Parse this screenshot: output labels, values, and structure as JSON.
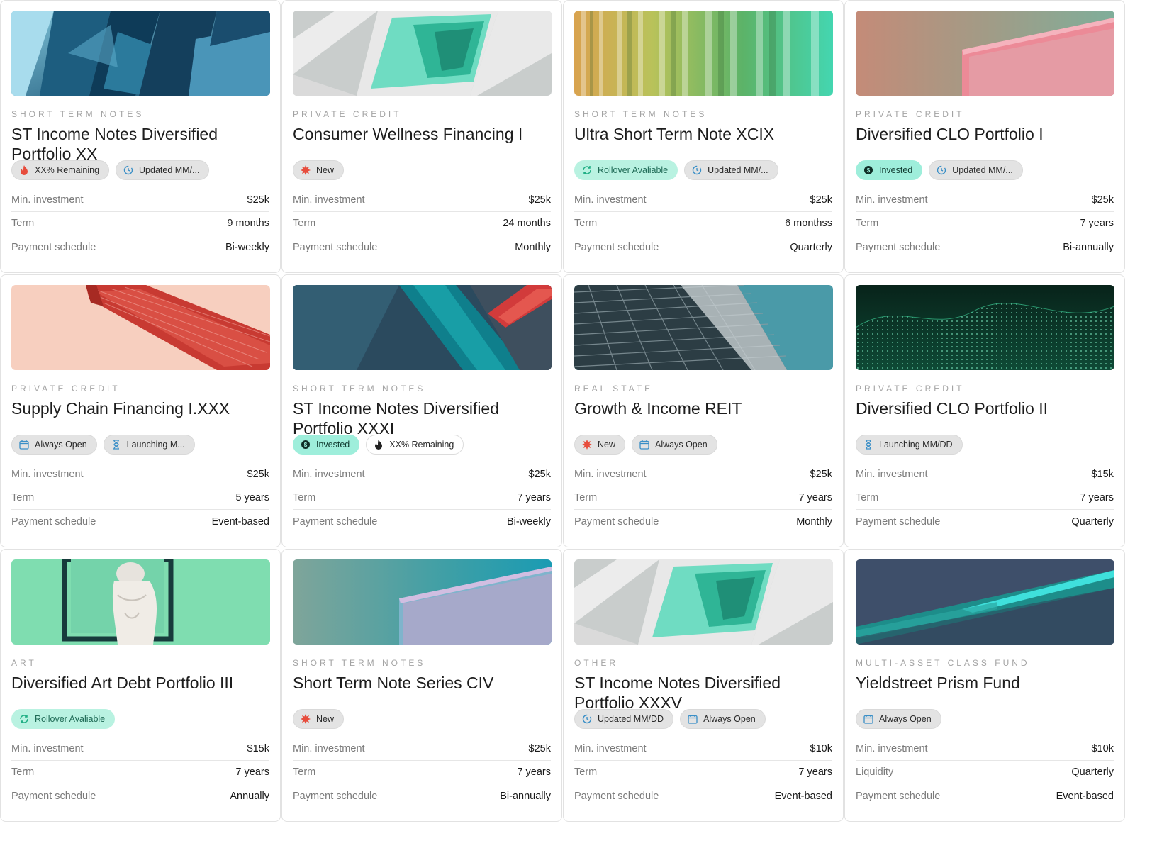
{
  "cards": [
    {
      "category": "SHORT TERM NOTES",
      "title": "ST Income Notes Diversified Portfolio XX",
      "tags": [
        {
          "label": "XX% Remaining",
          "icon": "flame-icon",
          "style": "plain"
        },
        {
          "label": "Updated MM/...",
          "icon": "refresh-clock-icon",
          "style": "plain"
        }
      ],
      "rows": [
        {
          "k": "Min. investment",
          "v": "$25k"
        },
        {
          "k": "Term",
          "v": "9 months"
        },
        {
          "k": "Payment schedule",
          "v": "Bi-weekly"
        }
      ]
    },
    {
      "category": "PRIVATE CREDIT",
      "title": "Consumer Wellness Financing I",
      "tags": [
        {
          "label": "New",
          "icon": "starburst-icon",
          "style": "plain"
        }
      ],
      "rows": [
        {
          "k": "Min. investment",
          "v": "$25k"
        },
        {
          "k": "Term",
          "v": "24 months"
        },
        {
          "k": "Payment schedule",
          "v": "Monthly"
        }
      ]
    },
    {
      "category": "SHORT TERM NOTES",
      "title": "Ultra Short Term Note XCIX",
      "tags": [
        {
          "label": "Rollover Avaliable",
          "icon": "rollover-icon",
          "style": "green"
        },
        {
          "label": "Updated MM/...",
          "icon": "refresh-clock-icon",
          "style": "plain"
        }
      ],
      "rows": [
        {
          "k": "Min. investment",
          "v": "$25k"
        },
        {
          "k": "Term",
          "v": "6 monthss"
        },
        {
          "k": "Payment schedule",
          "v": "Quarterly"
        }
      ]
    },
    {
      "category": "PRIVATE CREDIT",
      "title": "Diversified CLO Portfolio I",
      "tags": [
        {
          "label": "Invested",
          "icon": "dollar-coin-icon",
          "style": "invested"
        },
        {
          "label": "Updated MM/...",
          "icon": "refresh-clock-icon",
          "style": "plain"
        }
      ],
      "rows": [
        {
          "k": "Min. investment",
          "v": "$25k"
        },
        {
          "k": "Term",
          "v": "7 years"
        },
        {
          "k": "Payment schedule",
          "v": "Bi-annually"
        }
      ]
    },
    {
      "category": "PRIVATE CREDIT",
      "title": "Supply Chain Financing I.XXX",
      "tags": [
        {
          "label": "Always Open",
          "icon": "calendar-icon",
          "style": "plain"
        },
        {
          "label": "Launching M...",
          "icon": "hourglass-icon",
          "style": "plain"
        }
      ],
      "rows": [
        {
          "k": "Min. investment",
          "v": "$25k"
        },
        {
          "k": "Term",
          "v": "5 years"
        },
        {
          "k": "Payment schedule",
          "v": "Event-based"
        }
      ]
    },
    {
      "category": "SHORT TERM NOTES",
      "title": "ST Income Notes Diversified Portfolio XXXI",
      "tags": [
        {
          "label": "Invested",
          "icon": "dollar-coin-icon",
          "style": "invested"
        },
        {
          "label": "XX% Remaining",
          "icon": "flame-icon",
          "style": "outline"
        }
      ],
      "rows": [
        {
          "k": "Min. investment",
          "v": "$25k"
        },
        {
          "k": "Term",
          "v": "7 years"
        },
        {
          "k": "Payment schedule",
          "v": "Bi-weekly"
        }
      ]
    },
    {
      "category": "REAL STATE",
      "title": "Growth & Income REIT",
      "tags": [
        {
          "label": "New",
          "icon": "starburst-icon",
          "style": "plain"
        },
        {
          "label": "Always Open",
          "icon": "calendar-icon",
          "style": "plain"
        }
      ],
      "rows": [
        {
          "k": "Min. investment",
          "v": "$25k"
        },
        {
          "k": "Term",
          "v": "7 years"
        },
        {
          "k": "Payment schedule",
          "v": "Monthly"
        }
      ]
    },
    {
      "category": "PRIVATE CREDIT",
      "title": "Diversified CLO Portfolio II",
      "tags": [
        {
          "label": "Launching MM/DD",
          "icon": "hourglass-icon",
          "style": "plain"
        }
      ],
      "rows": [
        {
          "k": "Min. investment",
          "v": "$15k"
        },
        {
          "k": "Term",
          "v": "7 years"
        },
        {
          "k": "Payment schedule",
          "v": "Quarterly"
        }
      ]
    },
    {
      "category": "ART",
      "title": "Diversified Art Debt Portfolio III",
      "tags": [
        {
          "label": "Rollover Avaliable",
          "icon": "rollover-icon",
          "style": "green"
        }
      ],
      "rows": [
        {
          "k": "Min. investment",
          "v": "$15k"
        },
        {
          "k": "Term",
          "v": "7 years"
        },
        {
          "k": "Payment schedule",
          "v": "Annually"
        }
      ]
    },
    {
      "category": "SHORT TERM NOTES",
      "title": "Short Term Note Series CIV",
      "tags": [
        {
          "label": "New",
          "icon": "starburst-icon",
          "style": "plain"
        }
      ],
      "rows": [
        {
          "k": "Min. investment",
          "v": "$25k"
        },
        {
          "k": "Term",
          "v": "7 years"
        },
        {
          "k": "Payment schedule",
          "v": "Bi-annually"
        }
      ]
    },
    {
      "category": "OTHER",
      "title": "ST Income Notes Diversified Portfolio XXXV",
      "tags": [
        {
          "label": "Updated MM/DD",
          "icon": "refresh-clock-icon",
          "style": "plain"
        },
        {
          "label": "Always Open",
          "icon": "calendar-icon",
          "style": "plain"
        }
      ],
      "rows": [
        {
          "k": "Min. investment",
          "v": "$10k"
        },
        {
          "k": "Term",
          "v": "7 years"
        },
        {
          "k": "Payment schedule",
          "v": "Event-based"
        }
      ]
    },
    {
      "category": "MULTI-ASSET CLASS FUND",
      "title": "Yieldstreet Prism Fund",
      "tags": [
        {
          "label": "Always Open",
          "icon": "calendar-icon",
          "style": "plain"
        }
      ],
      "rows": [
        {
          "k": "Min. investment",
          "v": "$10k"
        },
        {
          "k": "Liquidity",
          "v": "Quarterly"
        },
        {
          "k": "Payment schedule",
          "v": "Event-based"
        }
      ]
    }
  ]
}
